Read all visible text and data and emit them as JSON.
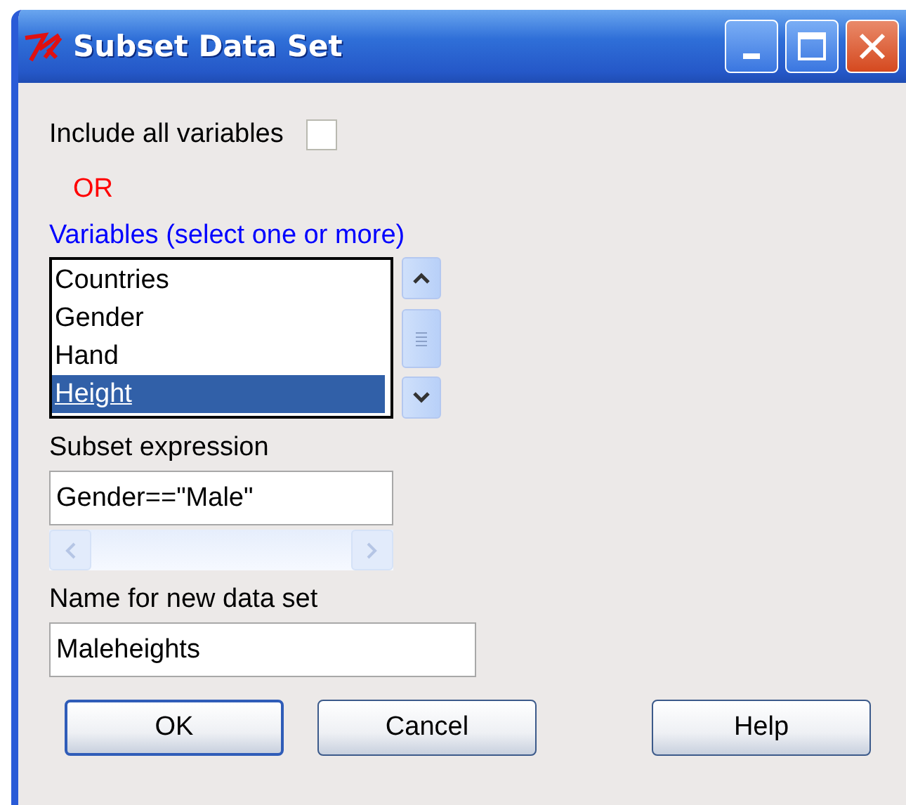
{
  "window": {
    "title": "Subset Data Set"
  },
  "include_all": {
    "label": "Include all variables",
    "checked": false
  },
  "or_label": "OR",
  "variables": {
    "label": "Variables (select one or more)",
    "items": [
      {
        "label": "Countries",
        "selected": false
      },
      {
        "label": "Gender",
        "selected": false
      },
      {
        "label": "Hand",
        "selected": false
      },
      {
        "label": "Height",
        "selected": true
      }
    ]
  },
  "subset_expression": {
    "label": "Subset expression",
    "value": "Gender==\"Male\""
  },
  "new_dataset": {
    "label": "Name for new data set",
    "value": "Maleheights"
  },
  "buttons": [
    {
      "label": "OK",
      "default": true
    },
    {
      "label": "Cancel",
      "default": false
    },
    {
      "label": "Help",
      "default": false
    }
  ]
}
